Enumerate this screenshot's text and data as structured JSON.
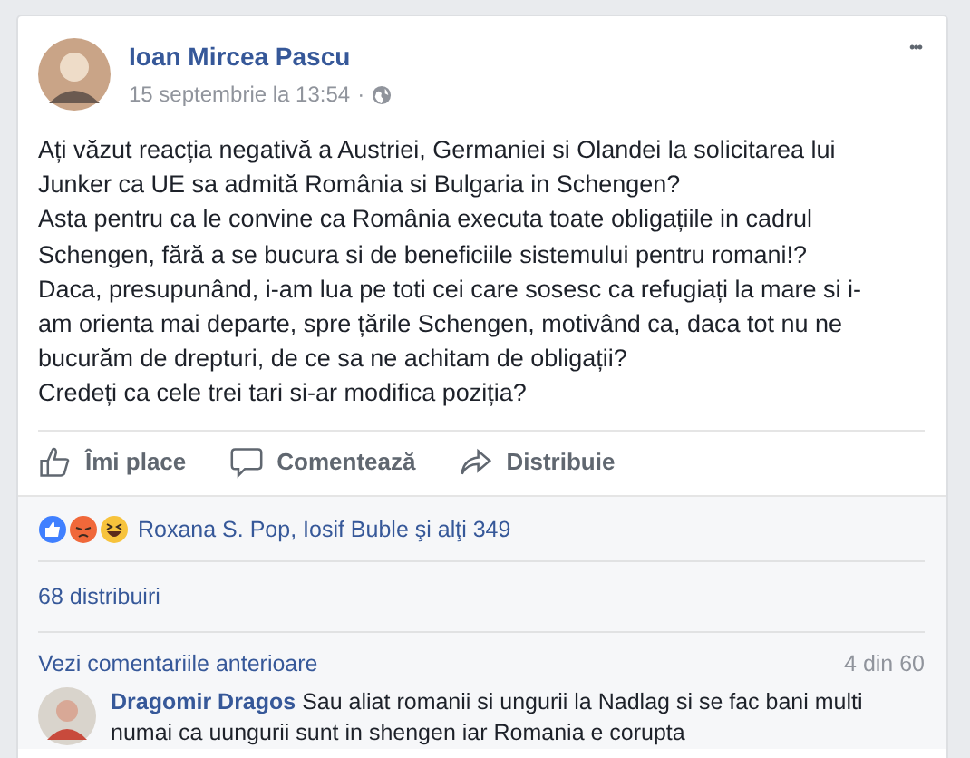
{
  "post": {
    "author": "Ioan Mircea Pascu",
    "time": "15 septembrie la 13:54",
    "separator": "·",
    "more": "•••",
    "paragraphs": [
      "Ați văzut reacția negativă a Austriei, Germaniei si Olandei la solicitarea lui Junker ca UE sa admită România si Bulgaria in Schengen?",
      "Asta pentru ca le convine ca România executa toate obligațiile in cadrul Schengen, fără a se bucura si de beneficiile sistemului pentru romani!?",
      "Daca, presupunând, i-am lua pe toti cei care sosesc ca refugiați la mare si i-am orienta mai departe, spre țările Schengen, motivând ca, daca tot nu ne bucurăm de drepturi, de ce sa ne achitam de obligații?",
      "Credeți ca cele trei tari si-ar modifica poziția?"
    ]
  },
  "actions": [
    {
      "kind": "like",
      "label": "Îmi place"
    },
    {
      "kind": "comment",
      "label": "Comentează"
    },
    {
      "kind": "share",
      "label": "Distribuie"
    }
  ],
  "reactions": {
    "icons": [
      {
        "kind": "like",
        "color": "#4080ff"
      },
      {
        "kind": "angry",
        "color": "#f0683a"
      },
      {
        "kind": "haha",
        "color": "#f7c33c"
      }
    ],
    "names": "Roxana S. Pop, Iosif Buble şi alţi 349"
  },
  "shares": "68 distribuiri",
  "comments": {
    "previous": "Vezi comentariile anterioare",
    "count": "4 din 60",
    "items": [
      {
        "author": "Dragomir Dragos",
        "text": "Sau aliat romanii si ungurii la Nadlag si se fac bani multi numai ca uungurii sunt in shengen iar Romania e corupta"
      }
    ]
  }
}
